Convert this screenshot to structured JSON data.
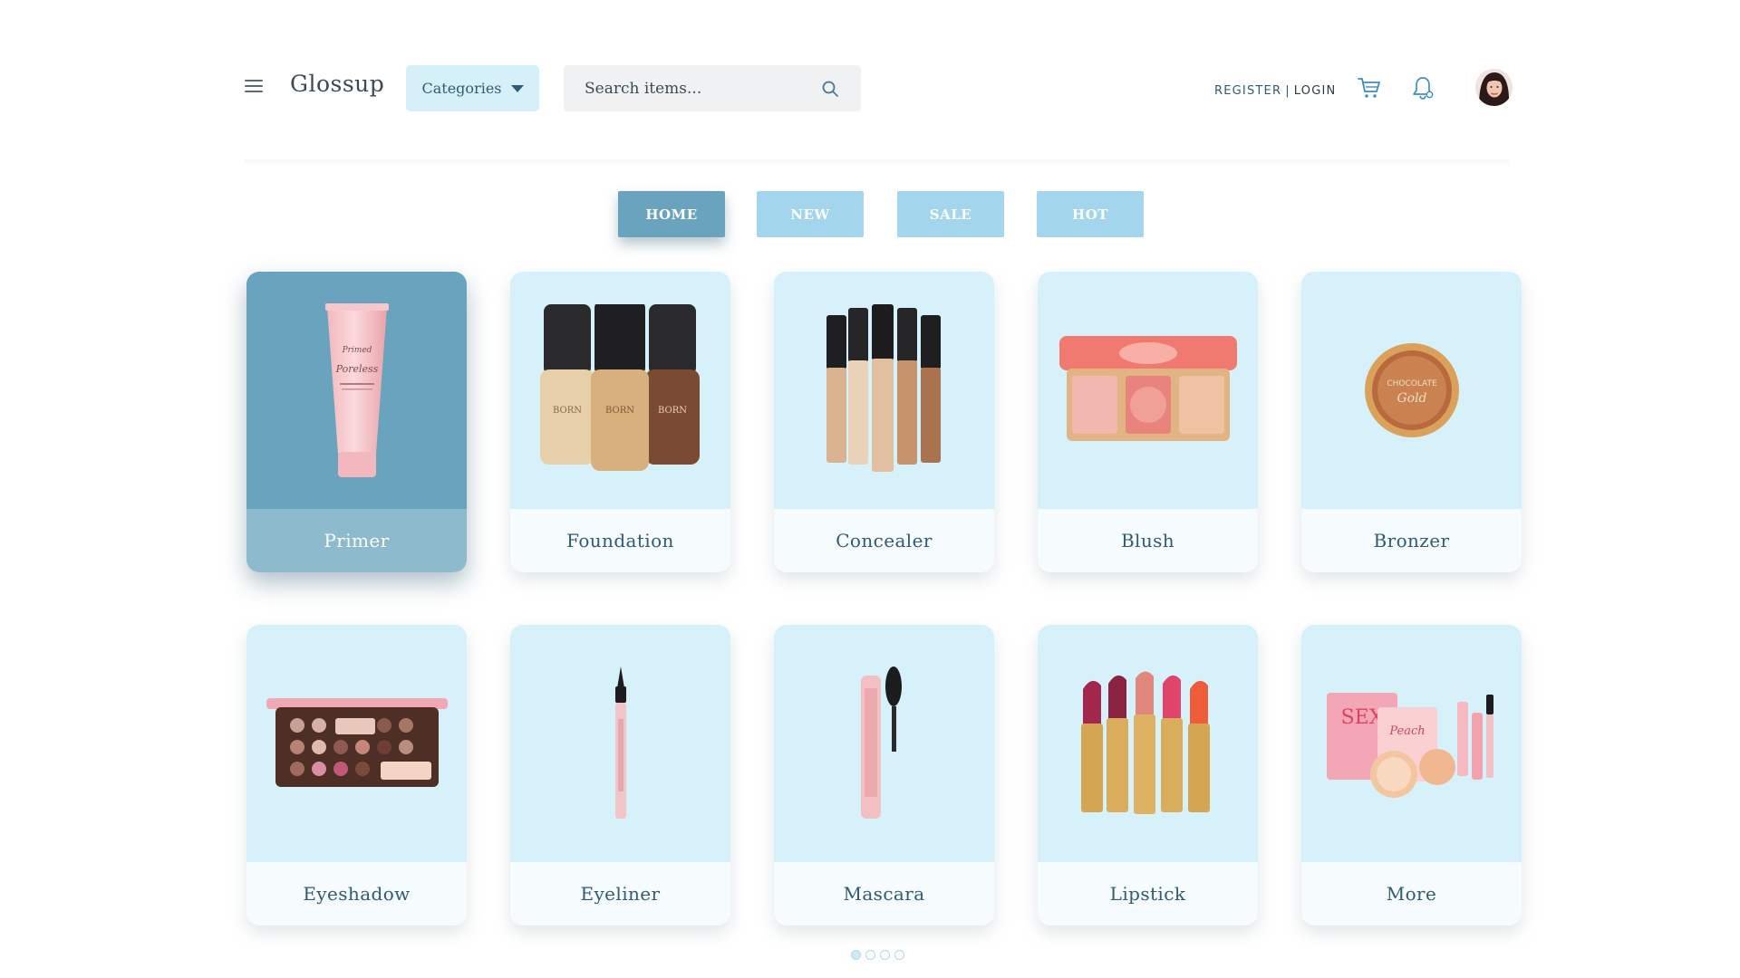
{
  "header": {
    "logo": "Glossup",
    "categories_label": "Categories",
    "search_placeholder": "Search items...",
    "register_label": "REGISTER",
    "separator": "|",
    "login_label": "LOGIN"
  },
  "nav": {
    "tabs": [
      {
        "label": "HOME",
        "active": true
      },
      {
        "label": "NEW",
        "active": false
      },
      {
        "label": "SALE",
        "active": false
      },
      {
        "label": "HOT",
        "active": false
      }
    ]
  },
  "categories": [
    {
      "label": "Primer",
      "icon": "primer-tube-icon",
      "selected": true
    },
    {
      "label": "Foundation",
      "icon": "foundation-bottles-icon",
      "selected": false
    },
    {
      "label": "Concealer",
      "icon": "concealer-wands-icon",
      "selected": false
    },
    {
      "label": "Blush",
      "icon": "blush-palette-icon",
      "selected": false
    },
    {
      "label": "Bronzer",
      "icon": "bronzer-compact-icon",
      "selected": false
    },
    {
      "label": "Eyeshadow",
      "icon": "eyeshadow-palette-icon",
      "selected": false
    },
    {
      "label": "Eyeliner",
      "icon": "eyeliner-pen-icon",
      "selected": false
    },
    {
      "label": "Mascara",
      "icon": "mascara-wand-icon",
      "selected": false
    },
    {
      "label": "Lipstick",
      "icon": "lipstick-set-icon",
      "selected": false
    },
    {
      "label": "More",
      "icon": "makeup-set-icon",
      "selected": false
    }
  ],
  "pagination": {
    "pages": 4,
    "current": 1
  },
  "colors": {
    "accent": "#6aa3bd",
    "tab_inactive": "#a3d6ec",
    "card_bg": "#d7f1fb",
    "text": "#2f5b73"
  }
}
